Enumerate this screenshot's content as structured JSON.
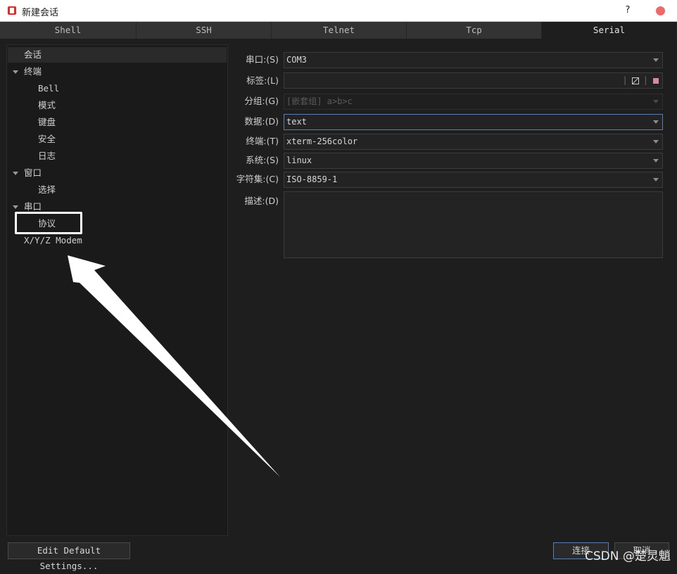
{
  "window": {
    "title": "新建会话",
    "help_label": "?"
  },
  "tabs": [
    {
      "label": "Shell"
    },
    {
      "label": "SSH"
    },
    {
      "label": "Telnet"
    },
    {
      "label": "Tcp"
    },
    {
      "label": "Serial"
    }
  ],
  "tree": [
    {
      "label": "会话"
    },
    {
      "label": "终端"
    },
    {
      "label": "Bell"
    },
    {
      "label": "模式"
    },
    {
      "label": "键盘"
    },
    {
      "label": "安全"
    },
    {
      "label": "日志"
    },
    {
      "label": "窗口"
    },
    {
      "label": "选择"
    },
    {
      "label": "串口"
    },
    {
      "label": "协议"
    },
    {
      "label": "X/Y/Z Modem"
    }
  ],
  "form": {
    "port": {
      "label": "串口:(S)",
      "value": "COM3"
    },
    "tag": {
      "label": "标签:(L)",
      "value": ""
    },
    "group": {
      "label": "分组:(G)",
      "placeholder": "[嵌套组] a>b>c"
    },
    "data": {
      "label": "数据:(D)",
      "value": "text"
    },
    "terminal": {
      "label": "终端:(T)",
      "value": "xterm-256color"
    },
    "system": {
      "label": "系统:(S)",
      "value": "linux"
    },
    "charset": {
      "label": "字符集:(C)",
      "value": "ISO-8859-1"
    },
    "description": {
      "label": "描述:(D)",
      "value": ""
    }
  },
  "buttons": {
    "edit_defaults": "Edit Default Settings...",
    "connect": "连接",
    "cancel": "取消"
  },
  "watermark": "CSDN @楚灵魈",
  "colors": {
    "close": "#ec6a6a",
    "app_icon": "#e02b2b",
    "focus_border": "#5b7db3",
    "annotation": "#ffffff"
  }
}
